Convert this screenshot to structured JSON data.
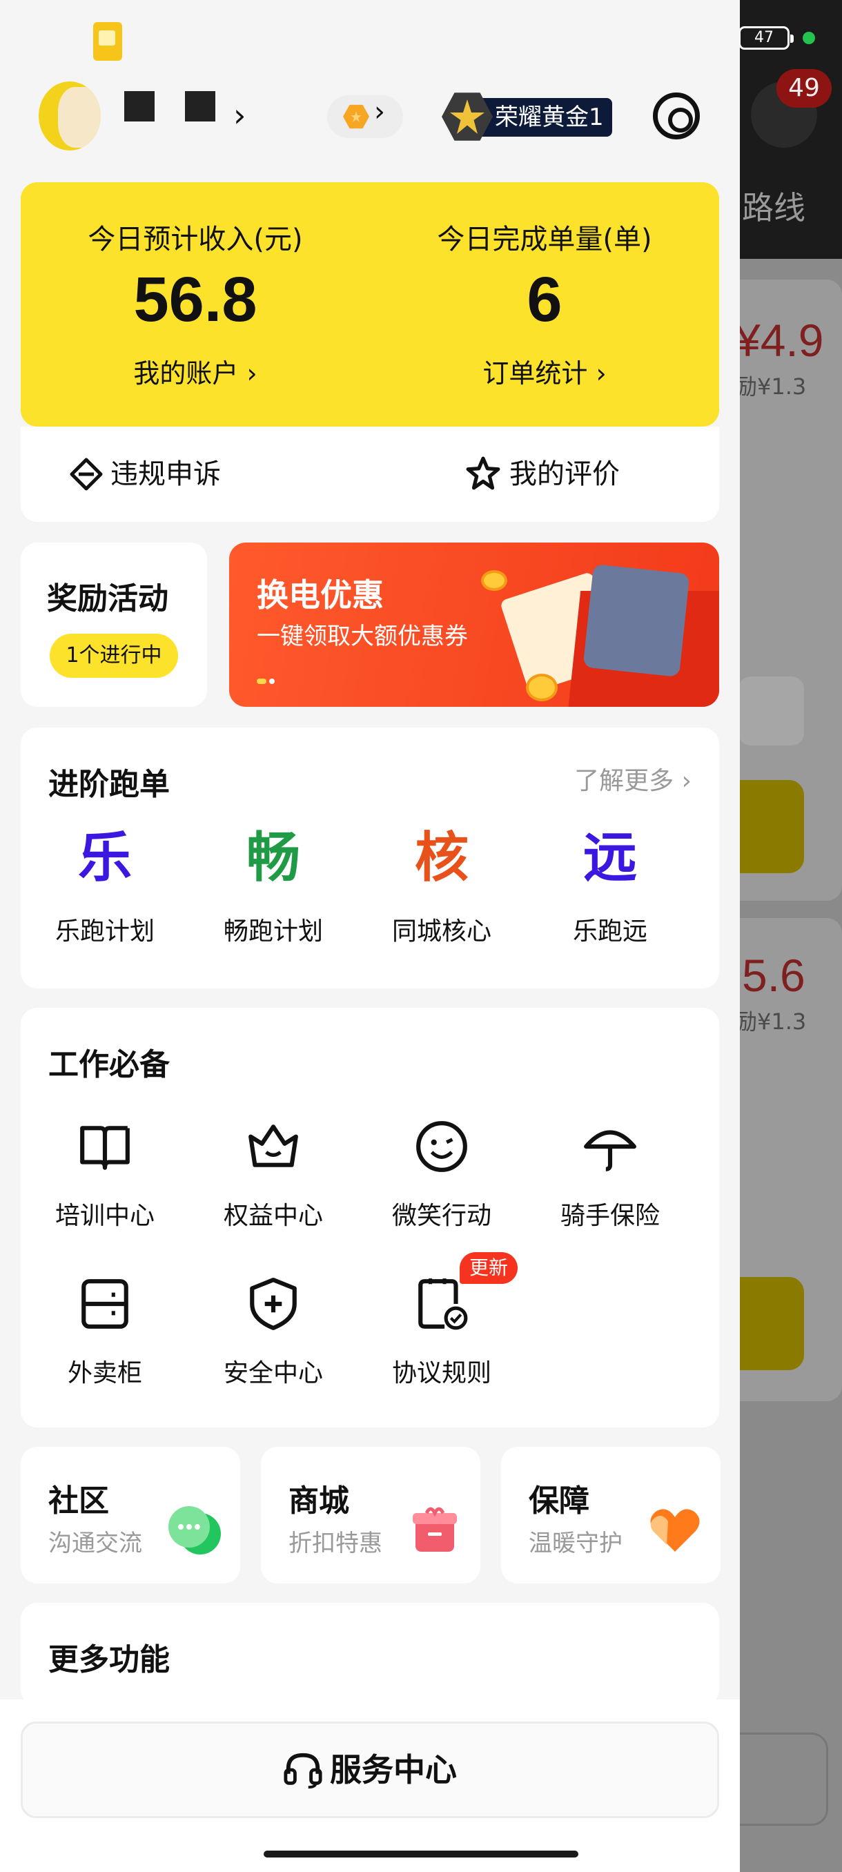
{
  "status_bar": {
    "battery": "47"
  },
  "background": {
    "notification_count": "49",
    "route_label": "路线",
    "price_1": "¥4.9",
    "subsidy_1": "励¥1.3",
    "price_2": "5.6",
    "subsidy_2": "励¥1.3"
  },
  "header": {
    "rank_label": "荣耀黄金1"
  },
  "income": {
    "left_label": "今日预计收入(元)",
    "left_value": "56.8",
    "left_link": "我的账户 ›",
    "right_label": "今日完成单量(单)",
    "right_value": "6",
    "right_link": "订单统计 ›"
  },
  "actions": {
    "appeal": "违规申诉",
    "review": "我的评价"
  },
  "reward": {
    "title": "奖励活动",
    "pill": "1个进行中"
  },
  "promo": {
    "title": "换电优惠",
    "subtitle": "一键领取大额优惠券"
  },
  "advanced": {
    "title": "进阶跑单",
    "more": "了解更多 ›",
    "items": [
      {
        "glyph": "乐",
        "label": "乐跑计划",
        "color": "#3b17e0"
      },
      {
        "glyph": "畅",
        "label": "畅跑计划",
        "color": "#1f9a45"
      },
      {
        "glyph": "核",
        "label": "同城核心",
        "color": "#e8521a"
      },
      {
        "glyph": "远",
        "label": "乐跑远",
        "color": "#3b17e0"
      }
    ]
  },
  "work": {
    "title": "工作必备",
    "items": [
      {
        "label": "培训中心",
        "icon": "book-icon"
      },
      {
        "label": "权益中心",
        "icon": "crown-icon"
      },
      {
        "label": "微笑行动",
        "icon": "smile-icon"
      },
      {
        "label": "骑手保险",
        "icon": "umbrella-icon"
      },
      {
        "label": "外卖柜",
        "icon": "locker-icon"
      },
      {
        "label": "安全中心",
        "icon": "shield-icon"
      },
      {
        "label": "协议规则",
        "icon": "agreement-icon",
        "badge": "更新"
      }
    ]
  },
  "mini_cards": [
    {
      "title": "社区",
      "subtitle": "沟通交流",
      "icon": "chat-icon"
    },
    {
      "title": "商城",
      "subtitle": "折扣特惠",
      "icon": "gift-icon"
    },
    {
      "title": "保障",
      "subtitle": "温暖守护",
      "icon": "heart-icon"
    }
  ],
  "more": {
    "title": "更多功能"
  },
  "service": {
    "label": "服务中心",
    "icon": "headset-icon"
  }
}
